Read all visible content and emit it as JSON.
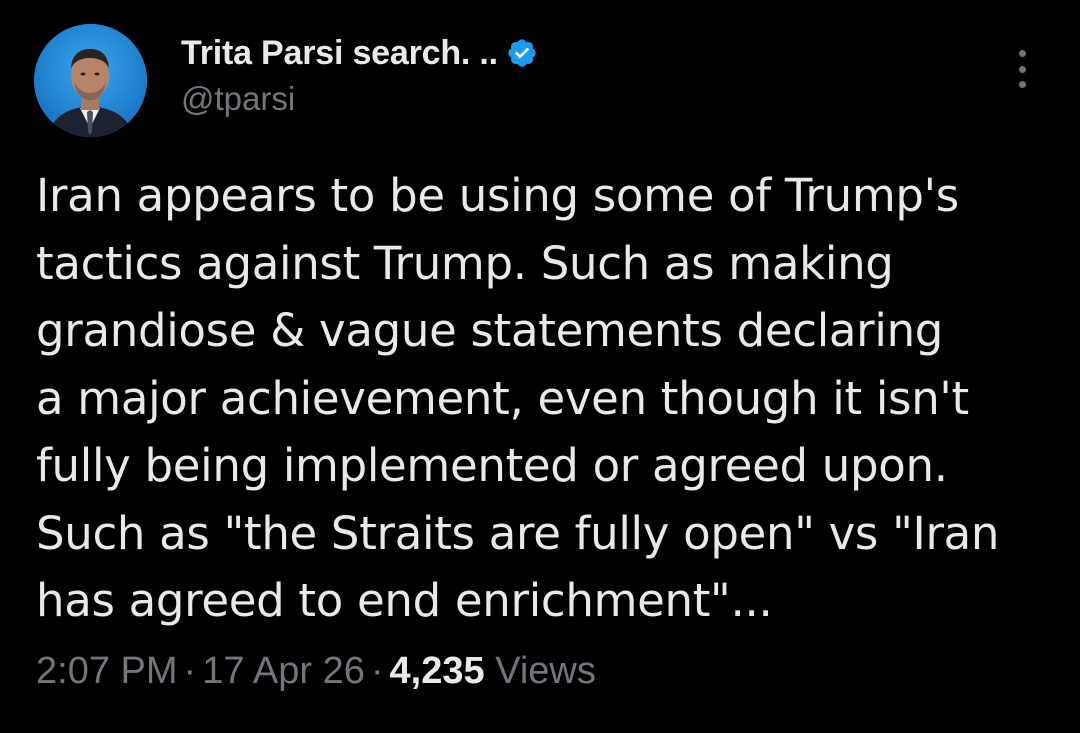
{
  "author": {
    "display_name": "Trita Parsi search. ..",
    "handle": "@tparsi",
    "verified_icon": "verified-badge-icon"
  },
  "menu_icon": "more-options-icon",
  "tweet": {
    "lines": [
      "Iran appears to be using some of Trump's",
      "tactics against Trump. Such as making",
      "grandiose & vague statements declaring",
      "a major achievement, even though it isn't",
      "fully being implemented or agreed upon.",
      "Such as \"the Straits are fully open\" vs \"Iran",
      "has agreed to end enrichment\"..."
    ]
  },
  "meta": {
    "time": "2:07 PM",
    "separator": "·",
    "date": "17 Apr 26",
    "views_count": "4,235",
    "views_label": "Views"
  },
  "colors": {
    "background": "#000000",
    "text_primary": "#e7e9ea",
    "text_secondary": "#71767b",
    "verified_blue": "#1d9bf0"
  }
}
